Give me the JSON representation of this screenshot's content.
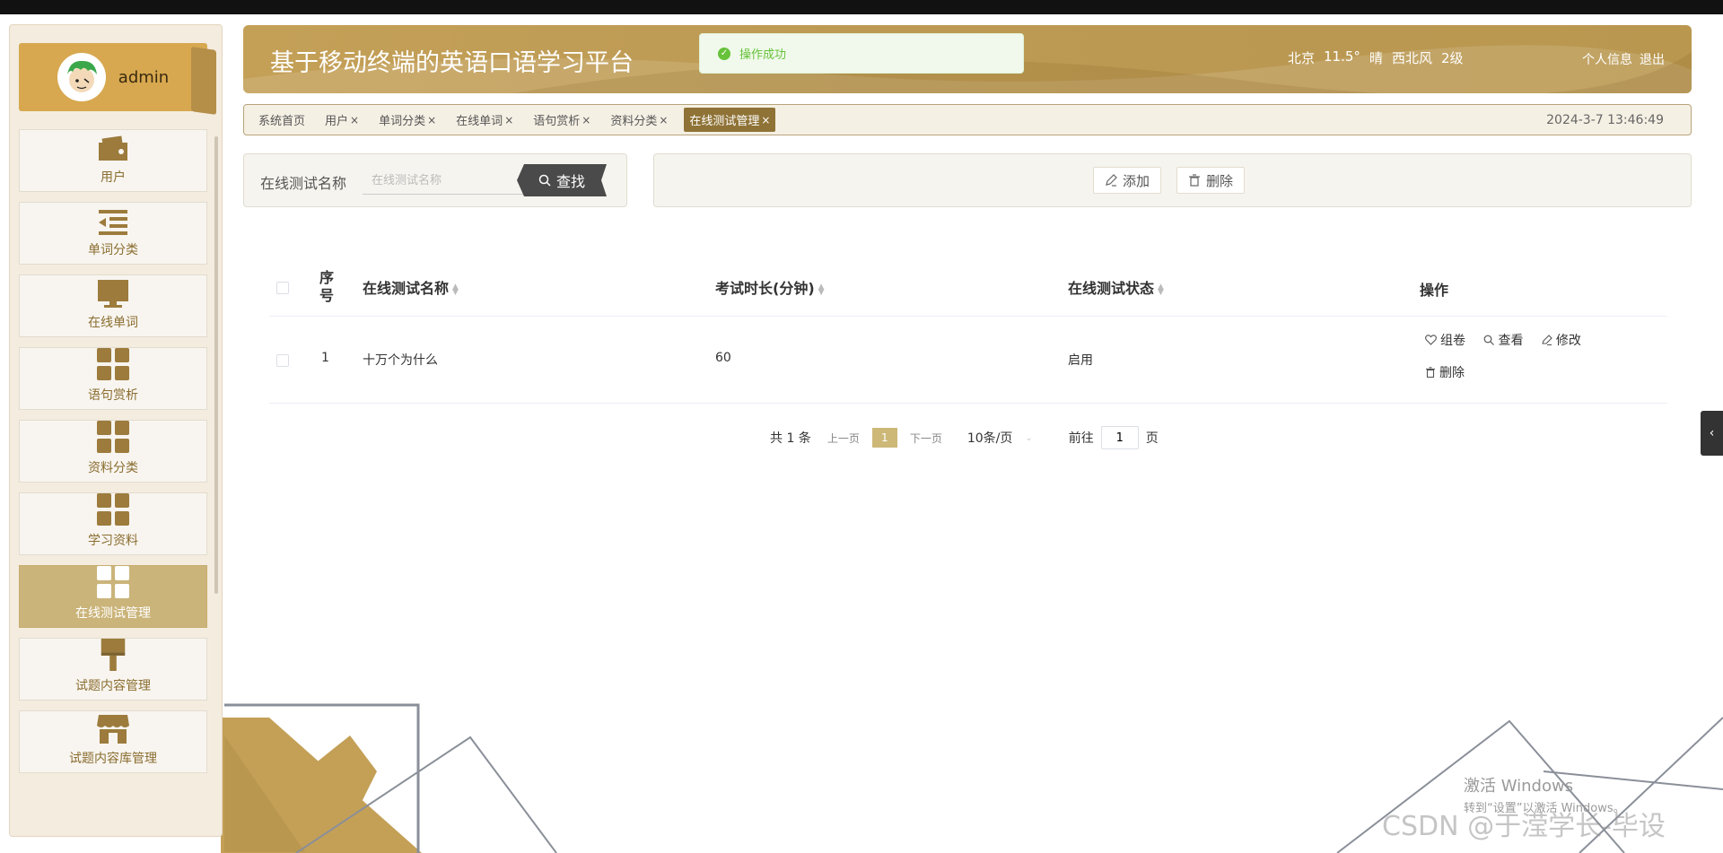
{
  "app": {
    "title": "基于移动终端的英语口语学习平台",
    "weather": {
      "city": "北京",
      "temp": "11.5°",
      "sky": "晴",
      "wind": "西北风",
      "level": "2级"
    },
    "links": {
      "profile": "个人信息",
      "logout": "退出"
    }
  },
  "toast": {
    "message": "操作成功"
  },
  "user": {
    "name": "admin"
  },
  "sidebar": {
    "items": [
      {
        "label": "用户",
        "icon": "wallet-icon"
      },
      {
        "label": "单词分类",
        "icon": "list-indent-icon"
      },
      {
        "label": "在线单词",
        "icon": "monitor-icon"
      },
      {
        "label": "语句赏析",
        "icon": "grid-icon"
      },
      {
        "label": "资料分类",
        "icon": "grid-icon"
      },
      {
        "label": "学习资料",
        "icon": "grid-icon"
      },
      {
        "label": "在线测试管理",
        "icon": "grid-icon",
        "active": true
      },
      {
        "label": "试题内容管理",
        "icon": "brush-icon"
      },
      {
        "label": "试题内容库管理",
        "icon": "store-icon"
      }
    ]
  },
  "tabs": {
    "items": [
      {
        "label": "系统首页",
        "closable": false
      },
      {
        "label": "用户",
        "closable": true
      },
      {
        "label": "单词分类",
        "closable": true
      },
      {
        "label": "在线单词",
        "closable": true
      },
      {
        "label": "语句赏析",
        "closable": true
      },
      {
        "label": "资料分类",
        "closable": true
      },
      {
        "label": "在线测试管理",
        "closable": true,
        "active": true
      }
    ],
    "close_glyph": "×",
    "datetime": "2024-3-7 13:46:49"
  },
  "search": {
    "label": "在线测试名称",
    "placeholder": "在线测试名称",
    "button": "查找"
  },
  "actions": {
    "add": "添加",
    "delete": "删除"
  },
  "table": {
    "headers": {
      "index": "序\n号",
      "name": "在线测试名称",
      "duration": "考试时长(分钟)",
      "status": "在线测试状态",
      "ops": "操作"
    },
    "rows": [
      {
        "index": "1",
        "name": "十万个为什么",
        "duration": "60",
        "status": "启用"
      }
    ],
    "row_ops": {
      "compose": "组卷",
      "view": "查看",
      "edit": "修改",
      "delete": "删除"
    }
  },
  "pagination": {
    "total": "共 1 条",
    "prev": "上一页",
    "current": "1",
    "next": "下一页",
    "page_size": "10条/页",
    "goto_prefix": "前往",
    "goto_value": "1",
    "goto_suffix": "页"
  },
  "windows": {
    "activate_title": "激活 Windows",
    "activate_hint": "转到“设置”以激活 Windows。"
  },
  "watermark": "CSDN @于滢学长-毕设",
  "colors": {
    "accent": "#bc9a54",
    "active_menu": "#cbb47a",
    "tab_active": "#8f7336",
    "success": "#67c23a"
  }
}
